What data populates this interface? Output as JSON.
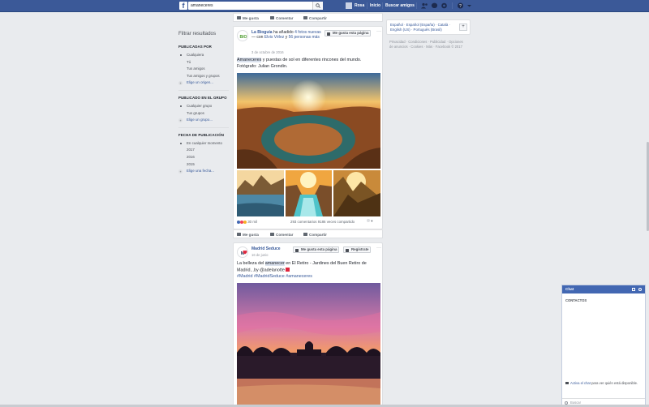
{
  "topbar": {
    "logo": "f",
    "search_value": "amaneceres",
    "nav": {
      "user": "Rosa",
      "home": "Inicio",
      "find_friends": "Buscar amigos"
    }
  },
  "filters": {
    "title": "Filtrar resultados",
    "posted_by": {
      "heading": "PUBLICADAS POR",
      "options": [
        "Cualquiera",
        "Tú",
        "Tus amigos",
        "Tus amigos y grupos"
      ],
      "choose": "Elige un origen..."
    },
    "posted_in_group": {
      "heading": "PUBLICADO EN EL GRUPO",
      "options": [
        "Cualquier grupo",
        "Tus grupos"
      ],
      "choose": "Elige un grupo..."
    },
    "date": {
      "heading": "FECHA DE PUBLICACIÓN",
      "options": [
        "En cualquier momento",
        "2017",
        "2016",
        "2015"
      ],
      "choose": "Elige una fecha..."
    }
  },
  "actions": {
    "like": "Me gusta",
    "comment": "Comentar",
    "share": "Compartir"
  },
  "post1": {
    "author": "La Bioguía",
    "added": "ha añadido",
    "photos": "4 fotos nuevas",
    "with": "— con",
    "friend": "Elvis Vélez",
    "and": "y",
    "others": "56 personas más",
    "date": "3 de octubre de 2016",
    "like_page": "Me gusta esta página",
    "text_highlight": "Amaneceres",
    "text_rest": " y puestas de sol en diferentes rincones del mundo. Fotógrafo: Julian Grondin.",
    "reactions": "30 mil",
    "comments": "293 comentarios",
    "shares": "9186 veces compartido"
  },
  "post2": {
    "author": "Madrid Seduce",
    "date": "16 de junio",
    "like_page": "Me gusta esta página",
    "sign_up": "Regístrate",
    "text_pre": "La belleza del ",
    "text_highlight": "amanecer",
    "text_mid": " en El Retiro - Jardines del Buen Retiro de Madrid...by @adelanotte ",
    "hashtags": "#Madrid #MadridSeduce #amaneceres"
  },
  "right": {
    "languages": "Español · Español (España) · Català · English (US) · Português (Brasil)",
    "footer": "Privacidad · Condiciones · Publicidad · Opciones de anuncios · Cookies · Más · Facebook © 2017"
  },
  "chat": {
    "title": "Chat",
    "contacts": "CONTACTOS",
    "activate_link": "Activa el chat",
    "activate_rest": " para ver quién está disponible.",
    "search": "Buscar"
  },
  "colors": {
    "brand": "#3b5998",
    "link": "#365899",
    "background": "#e9ebee"
  }
}
